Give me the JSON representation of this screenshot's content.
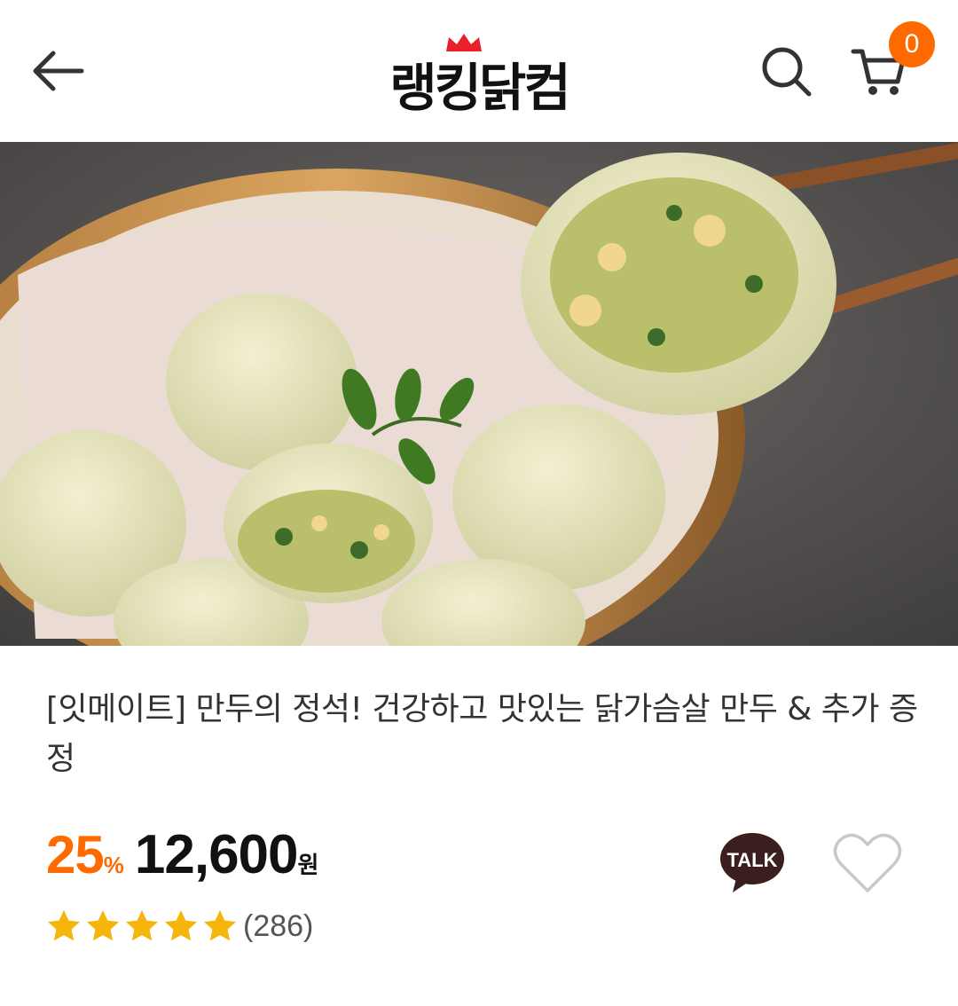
{
  "header": {
    "back_icon": "arrow-left-icon",
    "logo_text": "랭킹닭컴",
    "logo_icon": "crown-icon",
    "search_icon": "search-icon",
    "cart_icon": "cart-icon",
    "cart_count": "0"
  },
  "hero": {
    "image_subject": "steamed chicken breast dumplings in bamboo steamer"
  },
  "product": {
    "title": "[잇메이트] 만두의 정석! 건강하고 맛있는 닭가슴살 만두 & 추가 증정",
    "discount_percent": "25",
    "discount_unit": "%",
    "price": "12,600",
    "price_unit": "원",
    "rating": 5,
    "review_count": "(286)",
    "talk_label": "TALK",
    "talk_icon": "kakao-talk-icon",
    "wishlist_icon": "heart-icon"
  },
  "colors": {
    "accent": "#ff6a00",
    "star": "#f5b50a",
    "text": "#333333"
  }
}
